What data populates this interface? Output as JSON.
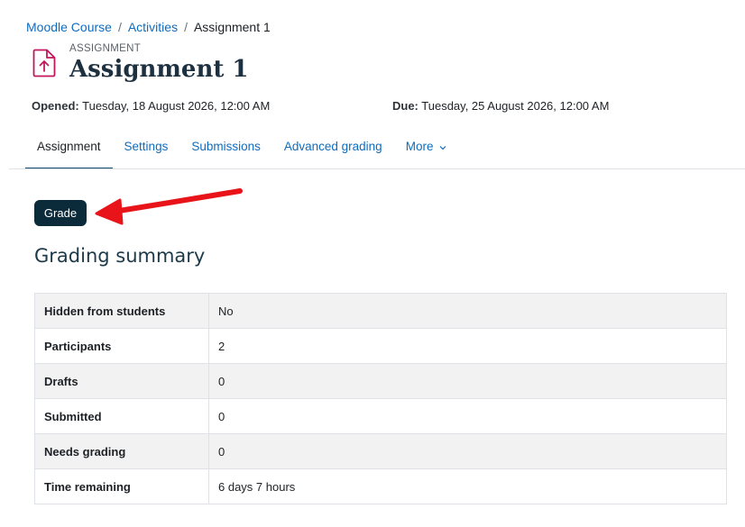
{
  "breadcrumb": {
    "items": [
      "Moodle Course",
      "Activities",
      "Assignment 1"
    ],
    "separator": "/"
  },
  "header": {
    "icon": "assignment-upload-icon",
    "pretitle": "ASSIGNMENT",
    "title": "Assignment 1",
    "opened_label": "Opened:",
    "opened_value": "Tuesday, 18 August 2026, 12:00 AM",
    "due_label": "Due:",
    "due_value": "Tuesday, 25 August 2026, 12:00 AM"
  },
  "tabs": [
    {
      "label": "Assignment",
      "active": true
    },
    {
      "label": "Settings",
      "active": false
    },
    {
      "label": "Submissions",
      "active": false
    },
    {
      "label": "Advanced grading",
      "active": false
    },
    {
      "label": "More",
      "active": false,
      "icon": "chevron-down-icon"
    }
  ],
  "actions": {
    "grade_label": "Grade"
  },
  "annotation": {
    "arrow_color": "#e8141a",
    "icon": "red-arrow-annotation"
  },
  "summary": {
    "heading": "Grading summary",
    "rows": [
      {
        "label": "Hidden from students",
        "value": "No"
      },
      {
        "label": "Participants",
        "value": "2"
      },
      {
        "label": "Drafts",
        "value": "0"
      },
      {
        "label": "Submitted",
        "value": "0"
      },
      {
        "label": "Needs grading",
        "value": "0"
      },
      {
        "label": "Time remaining",
        "value": "6 days 7 hours"
      }
    ]
  },
  "colors": {
    "link": "#0f6cbf",
    "brand_dark": "#0b2a3a",
    "icon_accent": "#c2185b"
  }
}
